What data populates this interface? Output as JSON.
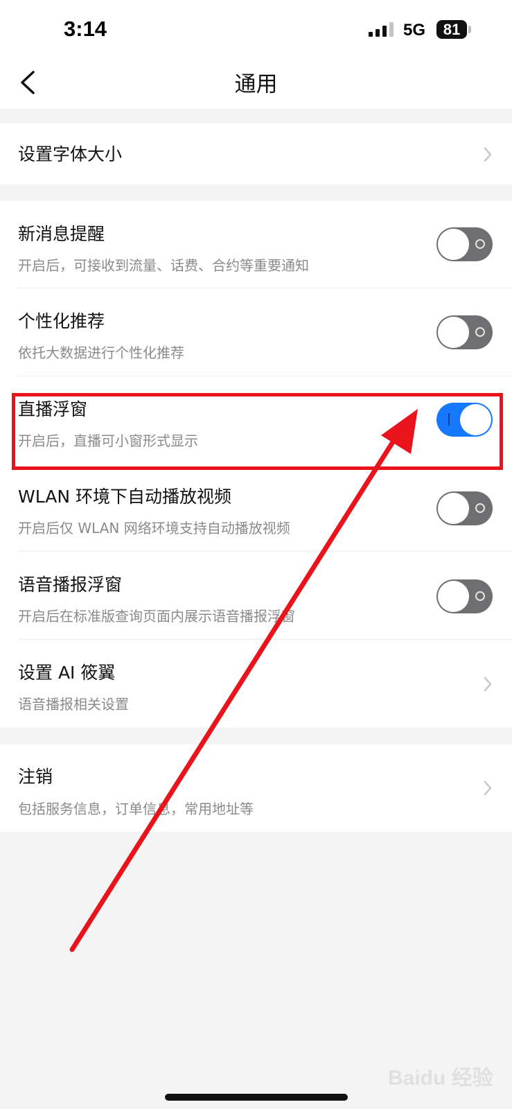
{
  "status_bar": {
    "time": "3:14",
    "network": "5G",
    "battery": "81"
  },
  "header": {
    "title": "通用"
  },
  "font_group": {
    "title": "设置字体大小"
  },
  "settings": [
    {
      "title": "新消息提醒",
      "subtitle": "开启后，可接收到流量、话费、合约等重要通知",
      "enabled": false
    },
    {
      "title": "个性化推荐",
      "subtitle": "依托大数据进行个性化推荐",
      "enabled": false
    },
    {
      "title": "直播浮窗",
      "subtitle": "开启后，直播可小窗形式显示",
      "enabled": true
    },
    {
      "title": "WLAN 环境下自动播放视频",
      "subtitle": "开启后仅 WLAN 网络环境支持自动播放视频",
      "enabled": false
    },
    {
      "title": "语音播报浮窗",
      "subtitle": "开启后在标准版查询页面内展示语音播报浮窗",
      "enabled": false
    },
    {
      "title": "设置 AI 筱翼",
      "subtitle": "语音播报相关设置"
    }
  ],
  "account_group": {
    "title": "注销",
    "subtitle": "包括服务信息，订单信息，常用地址等"
  },
  "watermark": "Baidu 经验",
  "colors": {
    "toggle_on": "#1677ff",
    "toggle_off": "#6f6f72",
    "annotation_red": "#e8131b"
  }
}
